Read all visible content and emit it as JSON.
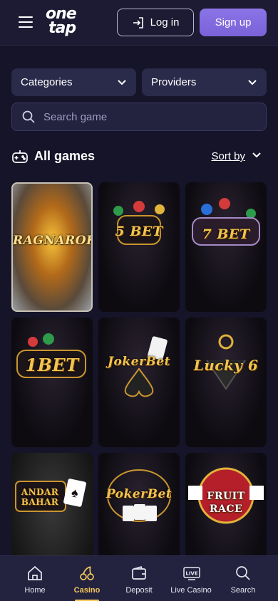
{
  "header": {
    "logo_line1": "one",
    "logo_line2": "tap",
    "login_label": "Log in",
    "signup_label": "Sign up"
  },
  "filters": {
    "categories_label": "Categories",
    "providers_label": "Providers",
    "search_placeholder": "Search game"
  },
  "section": {
    "title": "All games",
    "sort_label": "Sort by"
  },
  "games": [
    {
      "name": "Ragnarok",
      "label": "RAGNAROK"
    },
    {
      "name": "5 Bet",
      "label": "5 BET"
    },
    {
      "name": "7 Bet",
      "label": "7 BET"
    },
    {
      "name": "1 Bet",
      "label": "1BET"
    },
    {
      "name": "Joker Bet",
      "label": "JokerBet"
    },
    {
      "name": "Lucky 6",
      "label": "Lucky 6"
    },
    {
      "name": "Andar Bahar",
      "label": "ANDAR BAHAR"
    },
    {
      "name": "Poker Bet",
      "label": "PokerBet"
    },
    {
      "name": "Fruit Race",
      "label": "FRUIT RACE"
    }
  ],
  "nav": {
    "items": [
      {
        "label": "Home",
        "icon": "home-icon"
      },
      {
        "label": "Casino",
        "icon": "cherries-icon",
        "active": true
      },
      {
        "label": "Deposit",
        "icon": "wallet-icon"
      },
      {
        "label": "Live Casino",
        "icon": "live-tv-icon",
        "badge": "LIVE"
      },
      {
        "label": "Search",
        "icon": "search-icon"
      }
    ]
  },
  "colors": {
    "background": "#151428",
    "accent_purple": "#7a62d8",
    "accent_gold": "#f4c75a",
    "surface": "#2a2a4a"
  }
}
